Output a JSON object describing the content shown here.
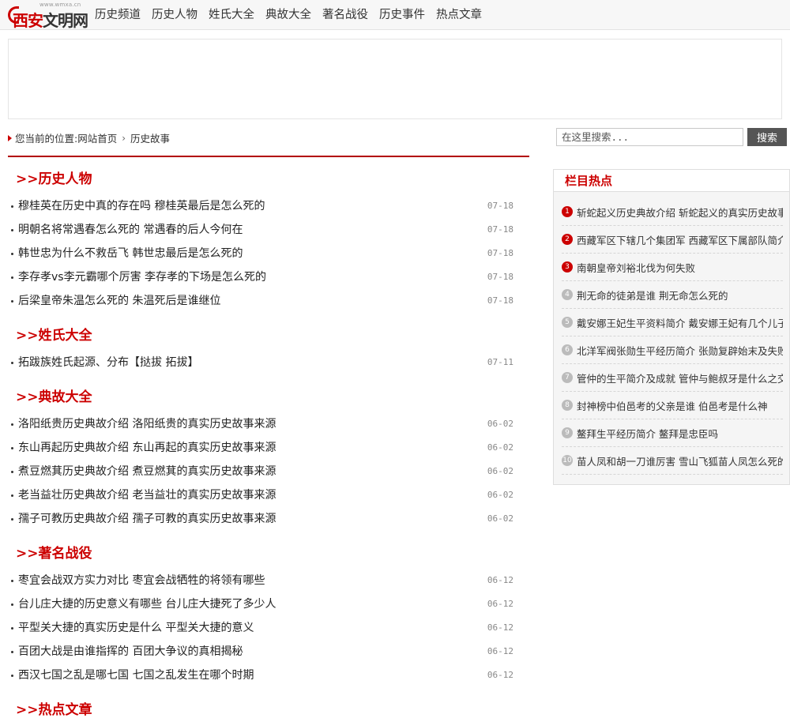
{
  "logo": {
    "small_text": "www.wmxa.cn",
    "main_text": "西安",
    "tail_text": "文明网"
  },
  "nav": [
    "历史频道",
    "历史人物",
    "姓氏大全",
    "典故大全",
    "著名战役",
    "历史事件",
    "热点文章"
  ],
  "breadcrumb": {
    "prefix": "您当前的位置:",
    "home": "网站首页",
    "current": "历史故事"
  },
  "search": {
    "placeholder": "在这里搜索...",
    "button": "搜索"
  },
  "sections": [
    {
      "title": ">>历史人物",
      "items": [
        {
          "title": "穆桂英在历史中真的存在吗 穆桂英最后是怎么死的",
          "date": "07-18"
        },
        {
          "title": "明朝名将常遇春怎么死的 常遇春的后人今何在",
          "date": "07-18"
        },
        {
          "title": "韩世忠为什么不救岳飞 韩世忠最后是怎么死的",
          "date": "07-18"
        },
        {
          "title": "李存孝vs李元霸哪个厉害 李存孝的下场是怎么死的",
          "date": "07-18"
        },
        {
          "title": "后梁皇帝朱温怎么死的 朱温死后是谁继位",
          "date": "07-18"
        }
      ]
    },
    {
      "title": ">>姓氏大全",
      "items": [
        {
          "title": "拓跋族姓氏起源、分布【挞拔 拓拔】",
          "date": "07-11"
        }
      ]
    },
    {
      "title": ">>典故大全",
      "items": [
        {
          "title": "洛阳纸贵历史典故介绍 洛阳纸贵的真实历史故事来源",
          "date": "06-02"
        },
        {
          "title": "东山再起历史典故介绍 东山再起的真实历史故事来源",
          "date": "06-02"
        },
        {
          "title": "煮豆燃萁历史典故介绍 煮豆燃萁的真实历史故事来源",
          "date": "06-02"
        },
        {
          "title": "老当益壮历史典故介绍 老当益壮的真实历史故事来源",
          "date": "06-02"
        },
        {
          "title": "孺子可教历史典故介绍 孺子可教的真实历史故事来源",
          "date": "06-02"
        }
      ]
    },
    {
      "title": ">>著名战役",
      "items": [
        {
          "title": "枣宜会战双方实力对比 枣宜会战牺牲的将领有哪些",
          "date": "06-12"
        },
        {
          "title": "台儿庄大捷的历史意义有哪些 台儿庄大捷死了多少人",
          "date": "06-12"
        },
        {
          "title": "平型关大捷的真实历史是什么 平型关大捷的意义",
          "date": "06-12"
        },
        {
          "title": "百团大战是由谁指挥的 百团大争议的真相揭秘",
          "date": "06-12"
        },
        {
          "title": "西汉七国之乱是哪七国 七国之乱发生在哪个时期",
          "date": "06-12"
        }
      ]
    },
    {
      "title": ">>热点文章",
      "items": []
    }
  ],
  "sidebar": {
    "title": "栏目热点",
    "items": [
      "斩蛇起义历史典故介绍 斩蛇起义的真实历史故事",
      "西藏军区下辖几个集团军 西藏军区下属部队简介",
      "南朝皇帝刘裕北伐为何失败",
      "荆无命的徒弟是谁 荆无命怎么死的",
      "戴安娜王妃生平资料简介 戴安娜王妃有几个儿子",
      "北洋军阀张勋生平经历简介 张勋复辟始末及失败",
      "管仲的生平简介及成就 管仲与鲍叔牙是什么之交",
      "封神榜中伯邑考的父亲是谁 伯邑考是什么神",
      "鳌拜生平经历简介 鳌拜是忠臣吗",
      "苗人凤和胡一刀谁厉害 雪山飞狐苗人凤怎么死的"
    ]
  }
}
